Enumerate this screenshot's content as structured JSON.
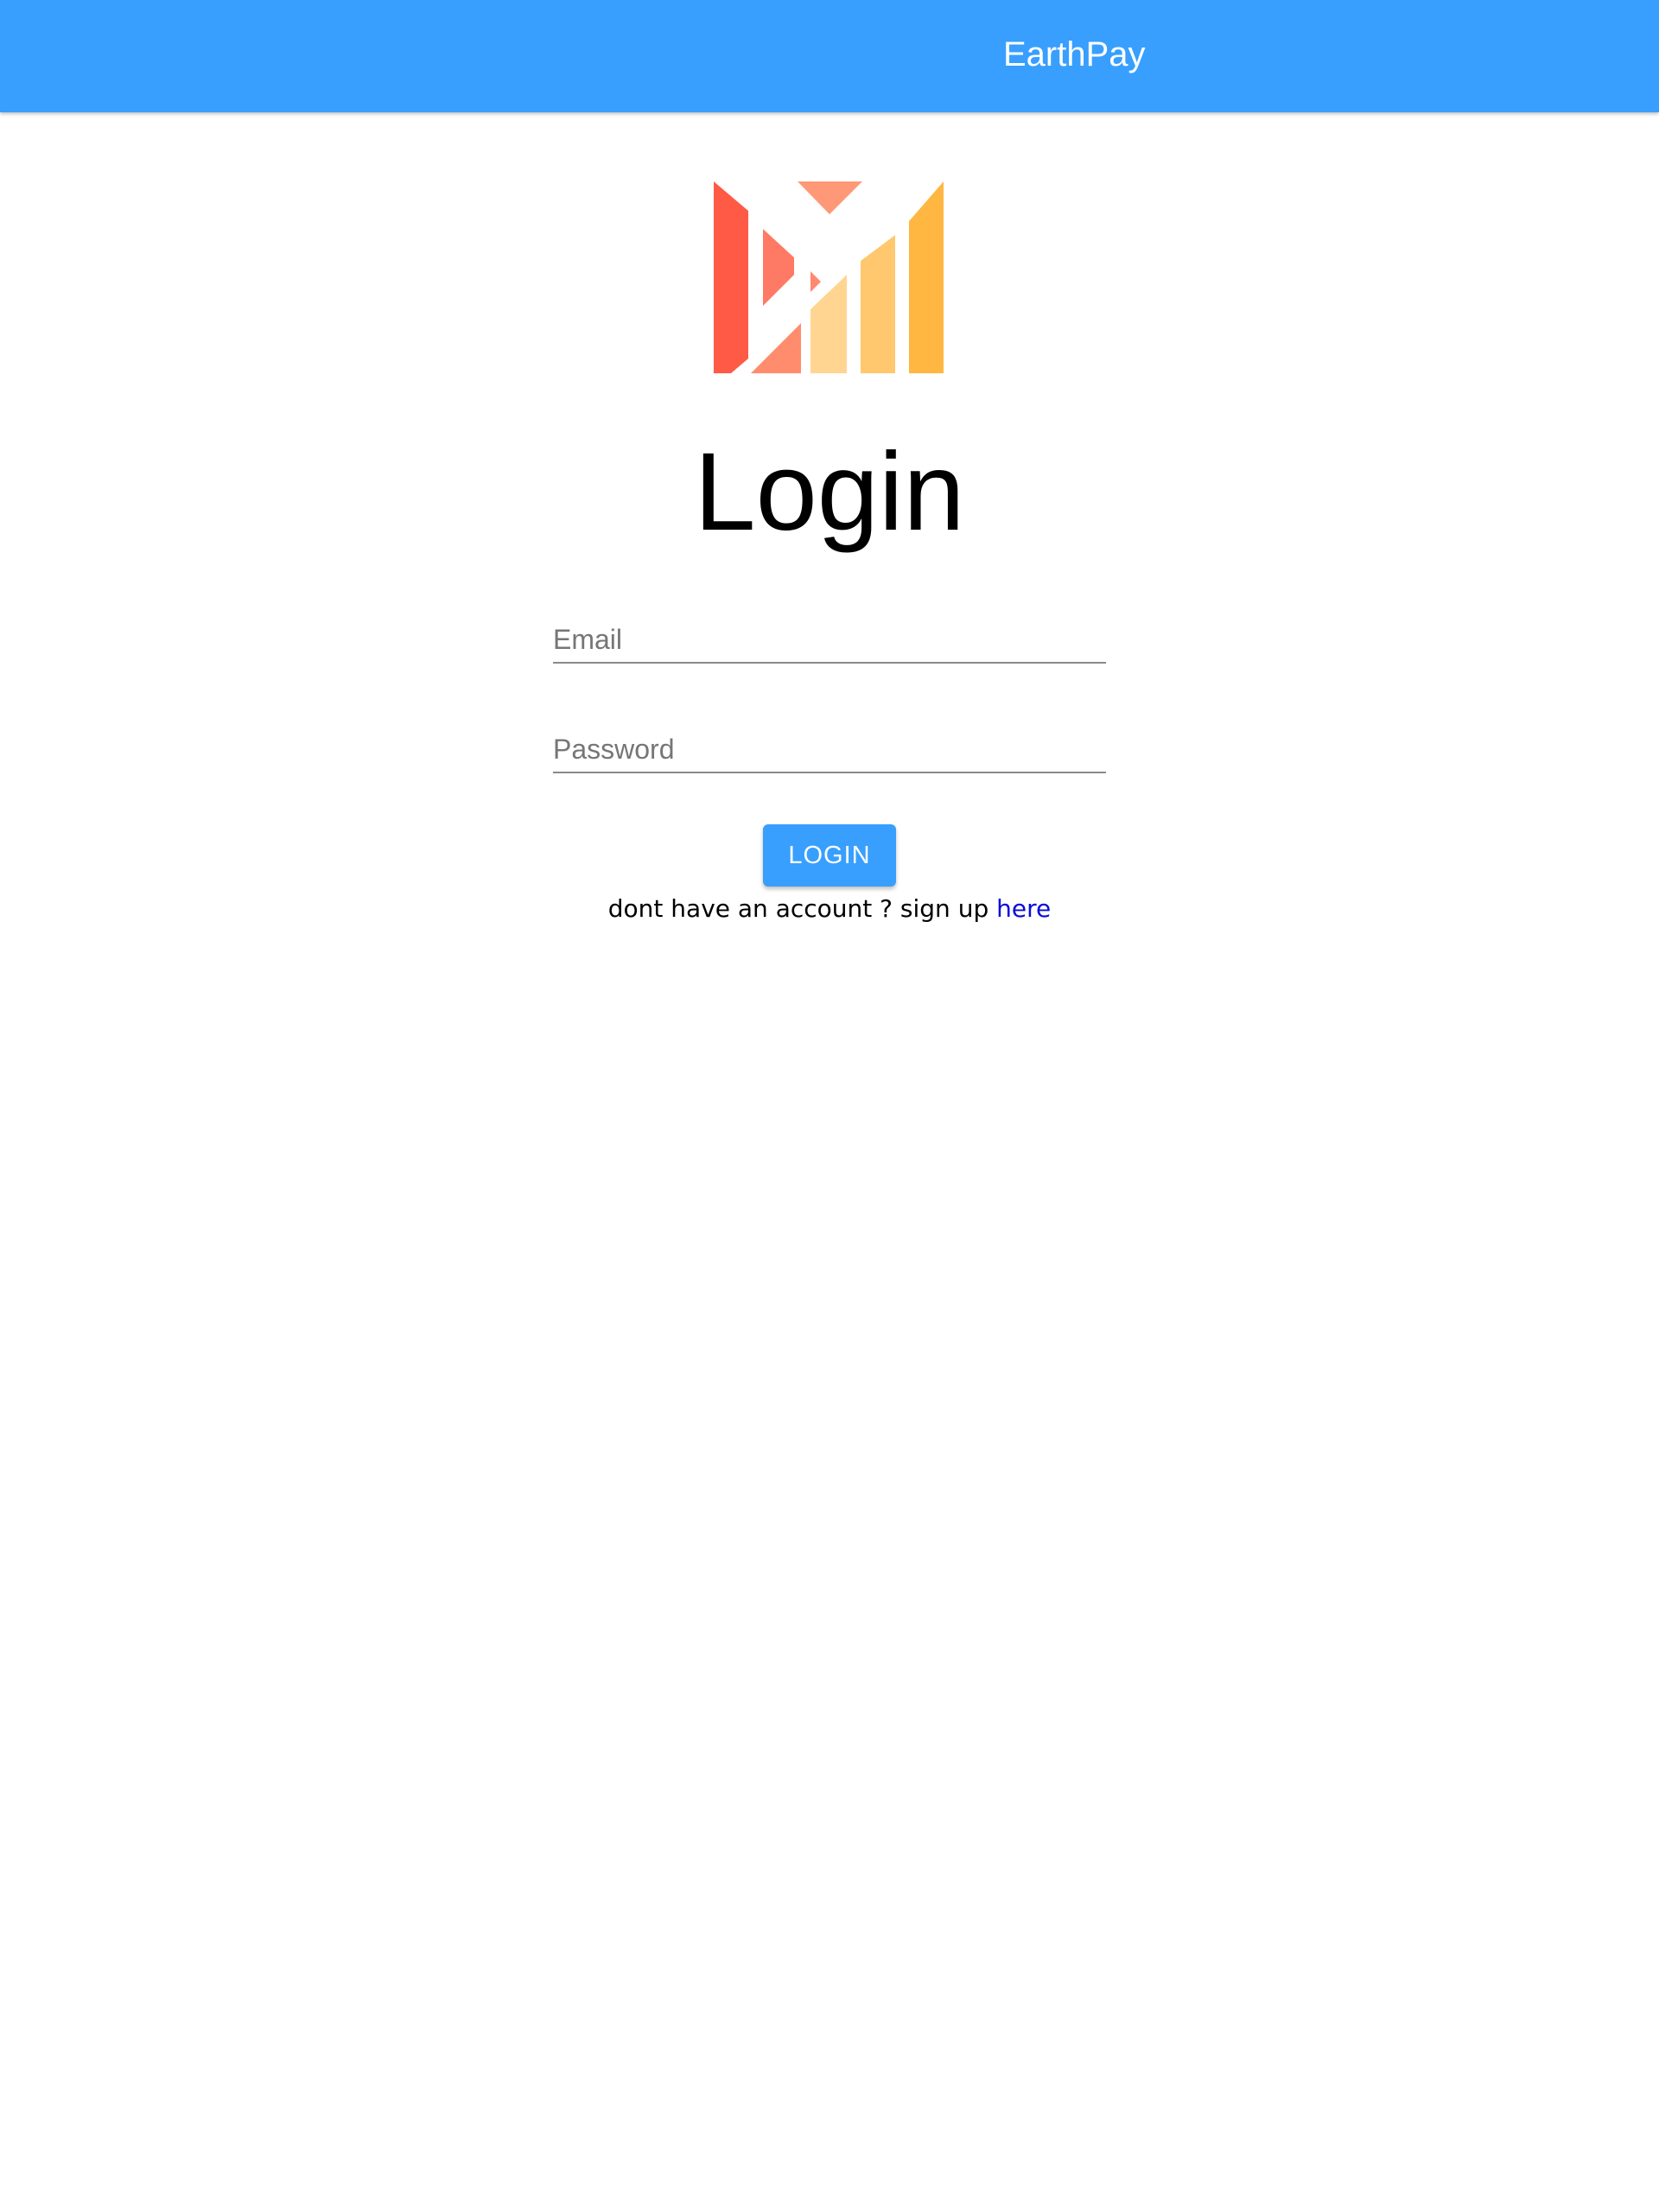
{
  "app_bar": {
    "title": "EarthPay",
    "background_color": "#389ffe"
  },
  "logo": {
    "icon": "m-logo-icon",
    "colors": [
      "#ff5a45",
      "#ff8a72",
      "#ffd591",
      "#ffc66b",
      "#ffb742",
      "#ff9876"
    ]
  },
  "login_form": {
    "title": "Login",
    "email": {
      "placeholder": "Email",
      "value": ""
    },
    "password": {
      "placeholder": "Password",
      "value": ""
    },
    "submit_label": "LOGIN",
    "signup_prompt": "dont have an account ? sign up ",
    "signup_link_label": "here",
    "link_color": "#0a0adc"
  }
}
